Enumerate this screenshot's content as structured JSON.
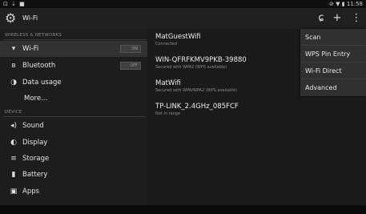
{
  "status_bar": {
    "left_icons": "⊡ ⇣ ■",
    "right_text": "⊘ ▼ ▮ 11:58"
  },
  "action_bar": {
    "title": "Wi-Fi",
    "app_icon": "gear-icon",
    "buttons": [
      {
        "name": "wps-button",
        "icon": "wps-icon",
        "glyph": "ɕ"
      },
      {
        "name": "add-network-button",
        "icon": "plus-icon",
        "glyph": "+"
      },
      {
        "name": "overflow-menu-button",
        "icon": "overflow-dots-icon",
        "glyph": "⋮"
      }
    ]
  },
  "sidebar": {
    "section_wireless": "WIRELESS & NETWORKS",
    "section_device": "DEVICE",
    "items": [
      {
        "label": "Wi-Fi",
        "icon": "wifi-icon",
        "glyph": "▾",
        "toggle": "ON",
        "selected": true
      },
      {
        "label": "Bluetooth",
        "icon": "bluetooth-icon",
        "glyph": "ʙ",
        "toggle": "OFF"
      },
      {
        "label": "Data usage",
        "icon": "data-usage-icon",
        "glyph": "◑"
      },
      {
        "label": "More...",
        "icon": "",
        "glyph": ""
      },
      {
        "label": "Sound",
        "icon": "sound-icon",
        "glyph": "◂)"
      },
      {
        "label": "Display",
        "icon": "display-icon",
        "glyph": "◐"
      },
      {
        "label": "Storage",
        "icon": "storage-icon",
        "glyph": "≡"
      },
      {
        "label": "Battery",
        "icon": "battery-icon",
        "glyph": "▮"
      },
      {
        "label": "Apps",
        "icon": "apps-icon",
        "glyph": "▣"
      }
    ]
  },
  "networks": [
    {
      "name": "MatGuestWifi",
      "status": "Connected"
    },
    {
      "name": "WIN-QFRFKMV9PKB-39880",
      "status": "Secured with WPA2 (WPS available)"
    },
    {
      "name": "MatWifi",
      "status": "Secured with WPA/WPA2 (WPS available)"
    },
    {
      "name": "TP-LINK_2.4GHz_085FCF",
      "status": "Not in range"
    }
  ],
  "overflow_menu": {
    "items": [
      {
        "label": "Scan"
      },
      {
        "label": "WPS Pin Entry"
      },
      {
        "label": "Wi-Fi Direct"
      },
      {
        "label": "Advanced"
      }
    ]
  }
}
